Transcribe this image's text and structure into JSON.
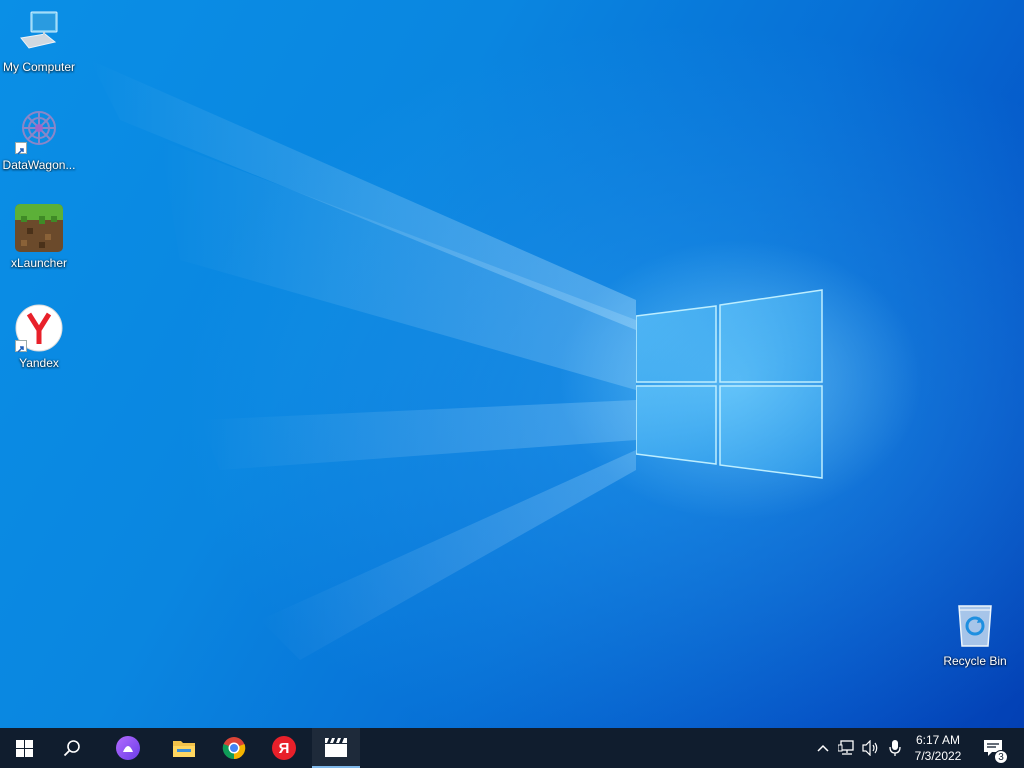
{
  "desktop": {
    "icons": [
      {
        "label": "My Computer",
        "icon": "computer-icon",
        "shortcut": false
      },
      {
        "label": "DataWagon...",
        "icon": "datawagon-icon",
        "shortcut": true
      },
      {
        "label": "xLauncher",
        "icon": "xlauncher-icon",
        "shortcut": false
      },
      {
        "label": "Yandex",
        "icon": "yandex-browser-icon",
        "shortcut": true
      }
    ],
    "recycle_bin": {
      "label": "Recycle Bin",
      "icon": "recycle-bin-icon"
    }
  },
  "taskbar": {
    "start": {
      "icon": "windows-start-icon"
    },
    "search": {
      "icon": "search-icon"
    },
    "pinned": [
      {
        "icon": "alice-assistant-icon"
      },
      {
        "icon": "file-explorer-icon"
      },
      {
        "icon": "chrome-icon"
      },
      {
        "icon": "yandex-icon",
        "text": "Я"
      },
      {
        "icon": "clapperboard-icon",
        "active": true
      }
    ],
    "tray": {
      "icons": [
        "chevron-up-icon",
        "network-icon",
        "volume-icon",
        "microphone-icon"
      ],
      "time": "6:17 AM",
      "date": "7/3/2022",
      "notifications_count": "3"
    }
  },
  "colors": {
    "taskbar_bg": "#101d2e",
    "desktop_accent": "#0a86e0",
    "yandex_red": "#e8202a"
  }
}
